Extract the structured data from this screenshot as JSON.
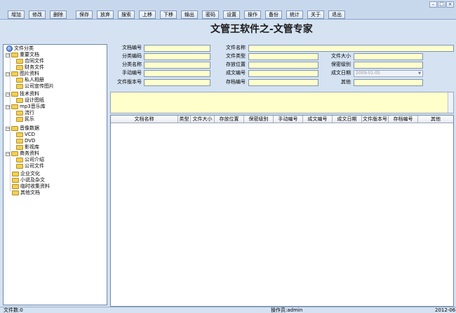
{
  "toolbar": {
    "buttons": [
      "增加",
      "修改",
      "删除",
      "保存",
      "放弃",
      "搜索",
      "上移",
      "下移",
      "输出",
      "密码",
      "设置",
      "操作",
      "备份",
      "统计",
      "关于",
      "退出"
    ]
  },
  "window_controls": {
    "minimize": "–",
    "maximize": "□",
    "close": "×"
  },
  "title": "文管王软件之-文管专家",
  "tree": {
    "root": "文件分类",
    "items": [
      "重要文档",
      "合同文件",
      "财务文件",
      "图片资料",
      "私人相册",
      "公司宣传图片",
      "技术资料",
      "设计图纸",
      "mp3音乐库",
      "流行",
      "民乐",
      "音像数据",
      "VCD",
      "DVD",
      "影视库",
      "商务资料",
      "公司介绍",
      "公司文件",
      "企业文化",
      "小说及杂文",
      "临时收集资料",
      "其他文档"
    ]
  },
  "form": {
    "labels": [
      "文档编号",
      "文件名称",
      "分类编码",
      "文件类型",
      "文件大小",
      "分类名称",
      "存放位置",
      "保密级别",
      "手动编号",
      "成文编号",
      "成文日期",
      "文件版本号",
      "存档编号",
      "其他"
    ],
    "date_value": "2009-01-05"
  },
  "grid": {
    "columns": [
      "文档名称",
      "类型",
      "文件大小",
      "存放位置",
      "保密级别",
      "手动编号",
      "成文编号",
      "成文日期",
      "文件版本号",
      "存档编号",
      "其他"
    ]
  },
  "status": {
    "count": "文件数:0",
    "operator": "操作员:admin",
    "date": "2012-06"
  }
}
